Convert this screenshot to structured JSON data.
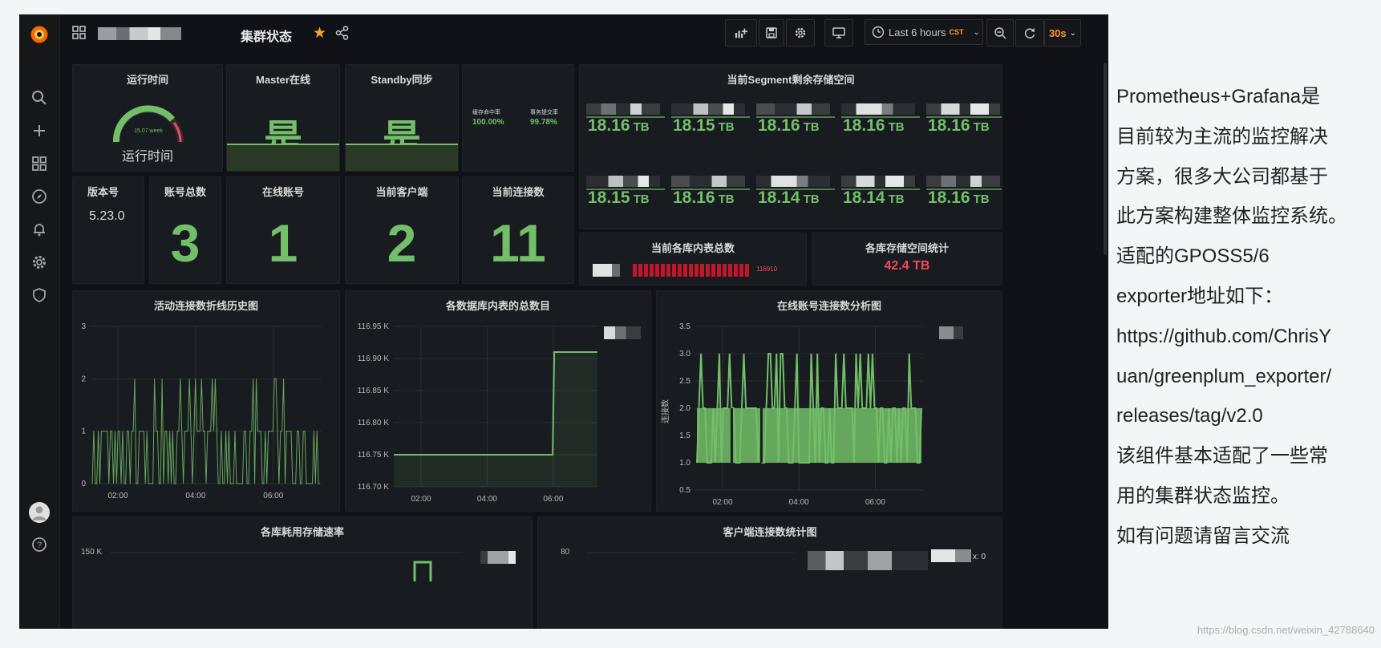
{
  "dashboard": {
    "title": "集群状态",
    "star_icon": "star-icon",
    "share_icon": "share-icon"
  },
  "toolbar": {
    "time_range": "Last 6 hours",
    "time_zone": "CST",
    "refresh_interval": "30s"
  },
  "panels": {
    "uptime": {
      "title": "运行时间",
      "gauge_value": "15.07 week",
      "label": "运行时间"
    },
    "master": {
      "title": "Master在线",
      "value": "是"
    },
    "standby": {
      "title": "Standby同步",
      "value": "是"
    },
    "rates": {
      "left_label": "缓存命中率",
      "left_value": "100.00%",
      "right_label": "事务提交率",
      "right_value": "99.78%"
    },
    "segment": {
      "title": "当前Segment剩余存储空间",
      "values": [
        "18.16",
        "18.15",
        "18.16",
        "18.16",
        "18.16",
        "18.15",
        "18.16",
        "18.14",
        "18.14",
        "18.16"
      ],
      "unit": "TB"
    },
    "version": {
      "title": "版本号",
      "value": "5.23.0"
    },
    "accounts": {
      "title": "账号总数",
      "value": "3"
    },
    "online": {
      "title": "在线账号",
      "value": "1"
    },
    "clients": {
      "title": "当前客户端",
      "value": "2"
    },
    "connections": {
      "title": "当前连接数",
      "value": "11"
    },
    "tables": {
      "title": "当前各库内表总数",
      "value": "116910"
    },
    "storage": {
      "title": "各库存储空间统计",
      "value": "42.4 TB"
    },
    "active_history": {
      "title": "活动连接数折线历史图",
      "y_ticks": [
        "3",
        "2",
        "1",
        "0"
      ],
      "x_ticks": [
        "02:00",
        "04:00",
        "06:00"
      ]
    },
    "table_count": {
      "title": "各数据库内表的总数目",
      "y_ticks": [
        "116.95 K",
        "116.90 K",
        "116.85 K",
        "116.80 K",
        "116.75 K",
        "116.70 K"
      ],
      "x_ticks": [
        "02:00",
        "04:00",
        "06:00"
      ]
    },
    "online_analysis": {
      "title": "在线账号连接数分析图",
      "y_label": "连接数",
      "y_ticks": [
        "3.5",
        "3.0",
        "2.5",
        "2.0",
        "1.5",
        "1.0",
        "0.5"
      ],
      "x_ticks": [
        "02:00",
        "04:00",
        "06:00"
      ]
    },
    "storage_rate": {
      "title": "各库耗用存储速率",
      "y_tick": "150 K"
    },
    "client_stats": {
      "title": "客户端连接数统计图",
      "y_tick": "80",
      "legend_x": "x: 0"
    }
  },
  "colors": {
    "green": "#73bf69",
    "red": "#f2495c",
    "orange": "#ff9830",
    "bg": "#111217",
    "panel": "#181b1f"
  },
  "note": {
    "lines": [
      "Prometheus+Grafana是",
      "目前较为主流的监控解决",
      "方案，很多大公司都基于",
      "此方案构建整体监控系统。",
      "适配的GPOSS5/6",
      "exporter地址如下：",
      "https://github.com/ChrisY",
      "uan/greenplum_exporter/",
      "releases/tag/v2.0",
      "该组件基本适配了一些常",
      "用的集群状态监控。",
      "如有问题请留言交流"
    ]
  },
  "watermark": "https://blog.csdn.net/weixin_42788640"
}
